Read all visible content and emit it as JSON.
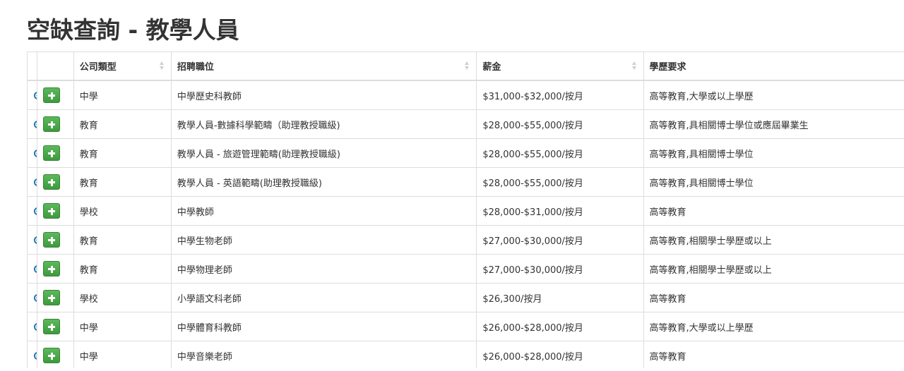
{
  "page": {
    "title": "空缺查詢 - 教學人員"
  },
  "table": {
    "headers": {
      "company_type": "公司類型",
      "job_title": "招聘職位",
      "salary": "薪金",
      "education": "學歷要求"
    },
    "rows": [
      {
        "company_type": "中學",
        "job_title": "中學歷史科教師",
        "salary": "$31,000-$32,000/按月",
        "education": "高等教育,大學或以上學歷"
      },
      {
        "company_type": "教育",
        "job_title": "教學人員-數據科學範疇（助理教授職級)",
        "salary": "$28,000-$55,000/按月",
        "education": "高等教育,具相關博士學位或應屆畢業生"
      },
      {
        "company_type": "教育",
        "job_title": "教學人員 - 旅遊管理範疇(助理教授職級)",
        "salary": "$28,000-$55,000/按月",
        "education": "高等教育,具相關博士學位"
      },
      {
        "company_type": "教育",
        "job_title": "教學人員 - 英語範疇(助理教授職級)",
        "salary": "$28,000-$55,000/按月",
        "education": "高等教育,具相關博士學位"
      },
      {
        "company_type": "學校",
        "job_title": "中學教師",
        "salary": "$28,000-$31,000/按月",
        "education": "高等教育"
      },
      {
        "company_type": "教育",
        "job_title": "中學生物老師",
        "salary": "$27,000-$30,000/按月",
        "education": "高等教育,相關學士學歷或以上"
      },
      {
        "company_type": "教育",
        "job_title": "中學物理老師",
        "salary": "$27,000-$30,000/按月",
        "education": "高等教育,相關學士學歷或以上"
      },
      {
        "company_type": "學校",
        "job_title": "小學語文科老師",
        "salary": "$26,300/按月",
        "education": "高等教育"
      },
      {
        "company_type": "中學",
        "job_title": "中學體育科教師",
        "salary": "$26,000-$28,000/按月",
        "education": "高等教育,大學或以上學歷"
      },
      {
        "company_type": "中學",
        "job_title": "中學音樂老師",
        "salary": "$26,000-$28,000/按月",
        "education": "高等教育"
      }
    ]
  },
  "icons": {
    "zoom": "zoom-in-icon",
    "add": "plus-icon"
  },
  "colors": {
    "add_button": "#4cae4c",
    "zoom_icon": "#2a7ab0",
    "border": "#dddddd"
  }
}
